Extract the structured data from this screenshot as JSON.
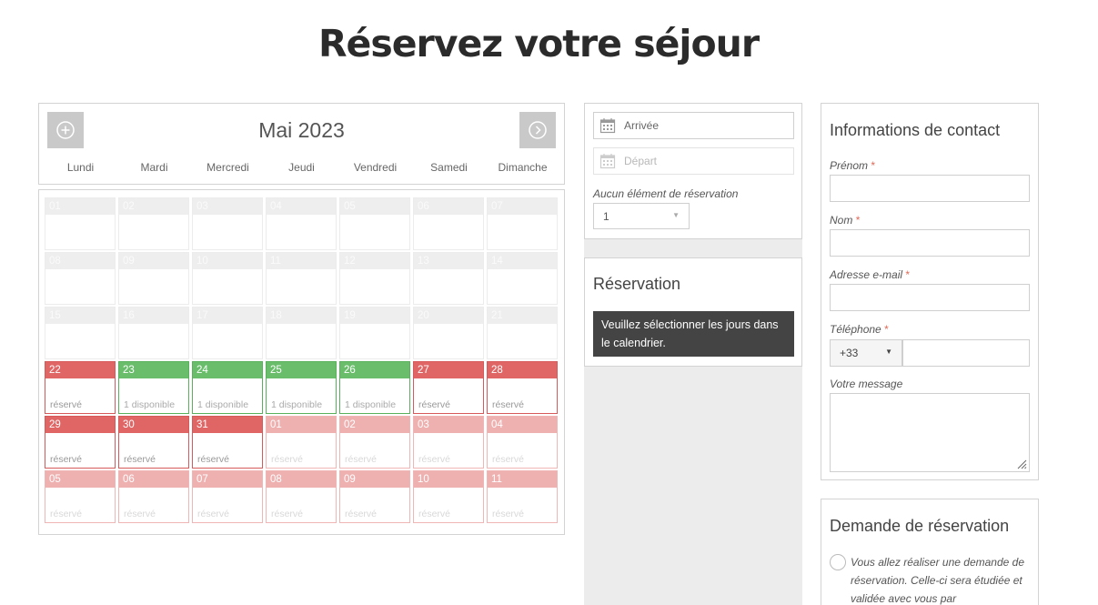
{
  "page": {
    "title": "Réservez votre séjour"
  },
  "calendar": {
    "month_label": "Mai 2023",
    "prev_icon": "plus-circle-icon",
    "next_icon": "chevron-right-circle-icon",
    "weekdays": [
      "Lundi",
      "Mardi",
      "Mercredi",
      "Jeudi",
      "Vendredi",
      "Samedi",
      "Dimanche"
    ],
    "status_colors": {
      "booked": "#e06666",
      "free": "#69bd6b",
      "light": "#efb0b0",
      "past": "#eeeeee"
    },
    "weeks": [
      [
        {
          "num": "01",
          "status": "",
          "state": "past"
        },
        {
          "num": "02",
          "status": "",
          "state": "past"
        },
        {
          "num": "03",
          "status": "",
          "state": "past"
        },
        {
          "num": "04",
          "status": "",
          "state": "past"
        },
        {
          "num": "05",
          "status": "",
          "state": "past"
        },
        {
          "num": "06",
          "status": "",
          "state": "past"
        },
        {
          "num": "07",
          "status": "",
          "state": "past"
        }
      ],
      [
        {
          "num": "08",
          "status": "",
          "state": "past"
        },
        {
          "num": "09",
          "status": "",
          "state": "past"
        },
        {
          "num": "10",
          "status": "",
          "state": "past"
        },
        {
          "num": "11",
          "status": "",
          "state": "past"
        },
        {
          "num": "12",
          "status": "",
          "state": "past"
        },
        {
          "num": "13",
          "status": "",
          "state": "past"
        },
        {
          "num": "14",
          "status": "",
          "state": "past"
        }
      ],
      [
        {
          "num": "15",
          "status": "",
          "state": "past"
        },
        {
          "num": "16",
          "status": "",
          "state": "past"
        },
        {
          "num": "17",
          "status": "",
          "state": "past"
        },
        {
          "num": "18",
          "status": "",
          "state": "past"
        },
        {
          "num": "19",
          "status": "",
          "state": "past"
        },
        {
          "num": "20",
          "status": "",
          "state": "past"
        },
        {
          "num": "21",
          "status": "",
          "state": "past"
        }
      ],
      [
        {
          "num": "22",
          "status": "réservé",
          "state": "booked"
        },
        {
          "num": "23",
          "status": "1 disponible",
          "state": "free"
        },
        {
          "num": "24",
          "status": "1 disponible",
          "state": "free"
        },
        {
          "num": "25",
          "status": "1 disponible",
          "state": "free"
        },
        {
          "num": "26",
          "status": "1 disponible",
          "state": "free"
        },
        {
          "num": "27",
          "status": "réservé",
          "state": "booked"
        },
        {
          "num": "28",
          "status": "réservé",
          "state": "booked"
        }
      ],
      [
        {
          "num": "29",
          "status": "réservé",
          "state": "booked"
        },
        {
          "num": "30",
          "status": "réservé",
          "state": "booked"
        },
        {
          "num": "31",
          "status": "réservé",
          "state": "booked"
        },
        {
          "num": "01",
          "status": "réservé",
          "state": "light"
        },
        {
          "num": "02",
          "status": "réservé",
          "state": "light"
        },
        {
          "num": "03",
          "status": "réservé",
          "state": "light"
        },
        {
          "num": "04",
          "status": "réservé",
          "state": "light"
        }
      ],
      [
        {
          "num": "05",
          "status": "réservé",
          "state": "light"
        },
        {
          "num": "06",
          "status": "réservé",
          "state": "light"
        },
        {
          "num": "07",
          "status": "réservé",
          "state": "light"
        },
        {
          "num": "08",
          "status": "réservé",
          "state": "light"
        },
        {
          "num": "09",
          "status": "réservé",
          "state": "light"
        },
        {
          "num": "10",
          "status": "réservé",
          "state": "light"
        },
        {
          "num": "11",
          "status": "réservé",
          "state": "light"
        }
      ]
    ]
  },
  "dates": {
    "arrival_placeholder": "Arrivée",
    "departure_placeholder": "Départ",
    "item_label": "Aucun élément de réservation",
    "quantity_value": "1",
    "icon": "calendar-icon"
  },
  "reservation": {
    "title": "Réservation",
    "notice": "Veuillez sélectionner les jours dans le calendrier."
  },
  "contact": {
    "title": "Informations de contact",
    "firstname_label": "Prénom",
    "lastname_label": "Nom",
    "email_label": "Adresse e-mail",
    "phone_label": "Téléphone",
    "phone_prefix": "+33",
    "message_label": "Votre message",
    "required_mark": "*"
  },
  "request": {
    "title": "Demande de réservation",
    "text": "Vous allez réaliser une demande de réservation. Celle-ci sera étudiée et validée avec vous par"
  }
}
